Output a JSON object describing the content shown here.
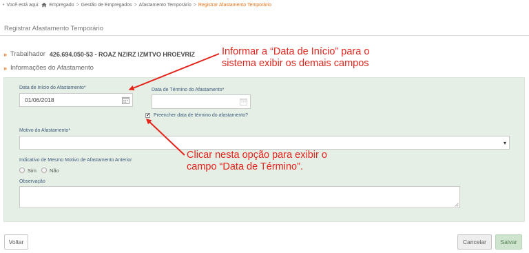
{
  "breadcrumb": {
    "prefix": "Você está aqui:",
    "items": [
      "Empregado",
      "Gestão de Empregados",
      "Afastamento Temporário",
      "Registrar Afastamento Temporário"
    ],
    "separator": ">"
  },
  "page": {
    "title": "Registrar Afastamento Temporário"
  },
  "worker": {
    "label": "Trabalhador",
    "value": "426.694.050-53 - ROAZ NZIRZ IZMTVO HROEVRIZ"
  },
  "section": {
    "title": "Informações do Afastamento"
  },
  "form": {
    "start_date": {
      "label": "Data de Início do Afastamento",
      "required_mark": "*",
      "value": "01/06/2018"
    },
    "end_date": {
      "label": "Data de Término do Afastamento",
      "required_mark": "*",
      "value": ""
    },
    "fill_end_date": {
      "label": "Preencher data de término do afastamento?",
      "checked_glyph": "✔"
    },
    "reason": {
      "label": "Motivo do Afastamento",
      "required_mark": "*",
      "value": "",
      "arrow": "▾"
    },
    "same_reason": {
      "label": "Indicativo de Mesmo Motivo de Afastamento Anterior",
      "options": [
        "Sim",
        "Não"
      ]
    },
    "notes": {
      "label": "Observação",
      "value": ""
    }
  },
  "callouts": {
    "start_date": [
      "Informar a “Data de Início” para o",
      "sistema exibir os demais campos"
    ],
    "end_date": [
      "Clicar nesta opção para exibir o",
      "campo “Data de Término”."
    ]
  },
  "buttons": {
    "back": "Voltar",
    "cancel": "Cancelar",
    "save": "Salvar"
  },
  "colors": {
    "accent_orange": "#e8731a",
    "panel_green": "#e6efe6",
    "callout_red": "#e4231b",
    "save_green": "#cfe4cf"
  },
  "icons": [
    "home-icon",
    "calendar-icon",
    "chevron-down-icon",
    "resize-grip-icon"
  ]
}
